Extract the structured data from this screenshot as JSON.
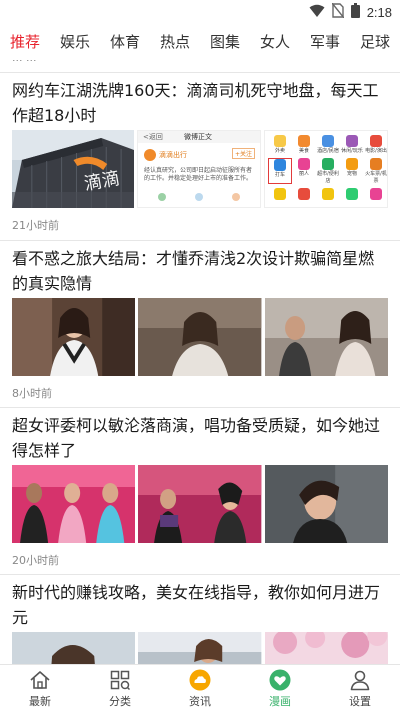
{
  "status_bar": {
    "time": "2:18",
    "icons": [
      "wifi-icon",
      "no-sim-icon",
      "battery-icon"
    ]
  },
  "tabs": [
    {
      "label": "推荐",
      "active": true
    },
    {
      "label": "娱乐",
      "active": false
    },
    {
      "label": "体育",
      "active": false
    },
    {
      "label": "热点",
      "active": false
    },
    {
      "label": "图集",
      "active": false
    },
    {
      "label": "女人",
      "active": false
    },
    {
      "label": "军事",
      "active": false
    },
    {
      "label": "足球",
      "active": false
    }
  ],
  "accent_color": "#e8232d",
  "active_nav_color": "#39b26b",
  "feed": {
    "articles": [
      {
        "title": "网约车江湖洗牌160天：滴滴司机死守地盘，每天工作超18小时",
        "time": "21小时前",
        "images": [
          "didi-building-photo",
          "weibo-post-screenshot",
          "app-grid-screenshot"
        ],
        "screenshot_texts": {
          "back": "<返回",
          "page_title": "微博正文",
          "poster": "滴滴出行",
          "follow": "+关注",
          "body": "经认真研究，公司即日起启动征服所有者的工作。并稳定处理好上市的准备工作。",
          "app_labels": [
            "外卖",
            "美食",
            "酒店/民宿",
            "休闲/玩乐",
            "电影/演出",
            "打车",
            "丽人",
            "超市/便利店",
            "宠物",
            "火车票/机票"
          ]
        }
      },
      {
        "title": "看不惑之旅大结局：才懂乔清浅2次设计欺骗简星燃的真实隐情",
        "time": "8小时前",
        "images": [
          "drama-still-1",
          "drama-still-2",
          "drama-still-3"
        ]
      },
      {
        "title": "超女评委柯以敏沦落商演，唱功备受质疑，如今她过得怎样了",
        "time": "20小时前",
        "images": [
          "tv-show-still",
          "stage-event-still",
          "portrait-photo"
        ]
      },
      {
        "title": "新时代的赚钱攻略，美女在线指导，教你如何月进万元",
        "time": "",
        "images": [
          "sunglasses-woman-photo",
          "outdoor-woman-photo",
          "cherry-blossom-photo"
        ]
      }
    ]
  },
  "bottom_nav": [
    {
      "label": "最新",
      "icon": "home-icon",
      "active": false
    },
    {
      "label": "分类",
      "icon": "grid-icon",
      "active": false
    },
    {
      "label": "资讯",
      "icon": "cloud-icon",
      "active": false
    },
    {
      "label": "漫画",
      "icon": "heart-icon",
      "active": true
    },
    {
      "label": "设置",
      "icon": "person-icon",
      "active": false
    }
  ]
}
